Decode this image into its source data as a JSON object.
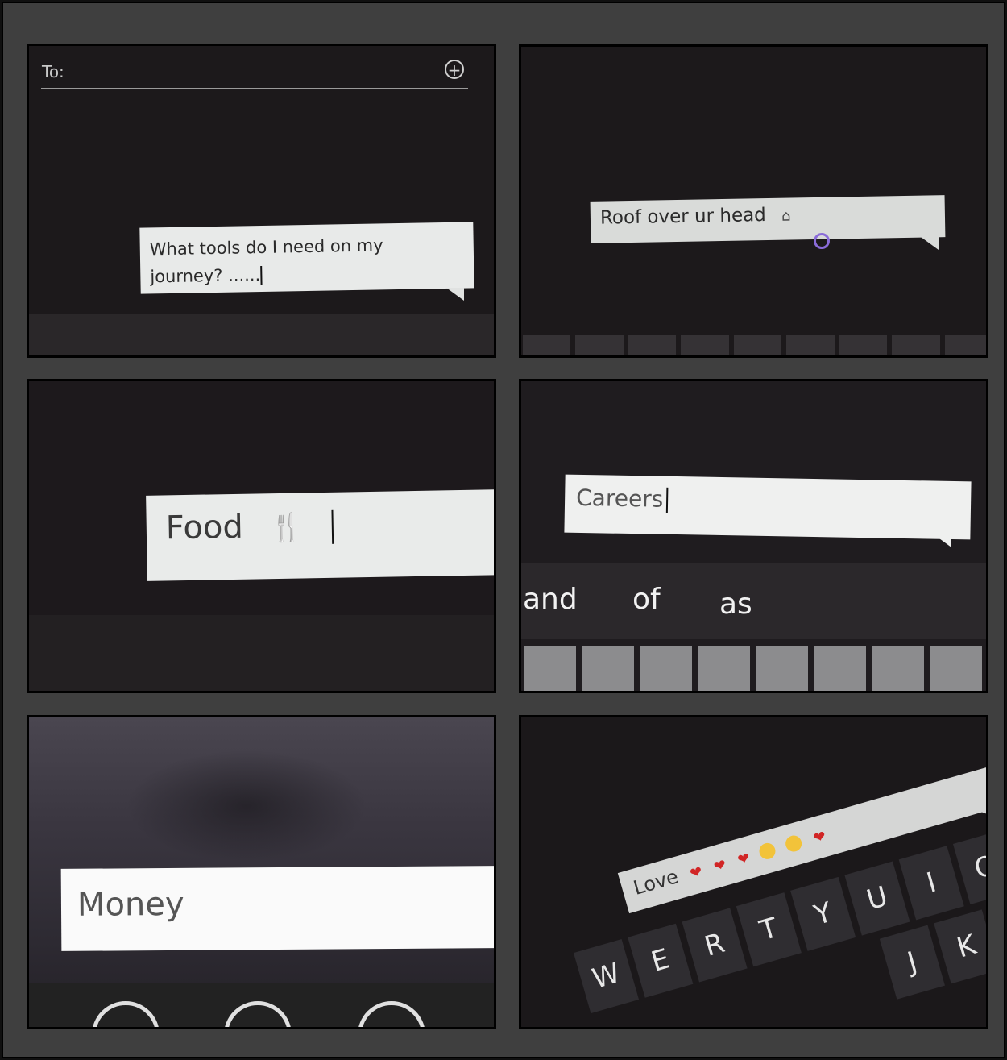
{
  "panel1": {
    "to_label": "To:",
    "add_icon": "add-circle-icon",
    "message_line1": "What tools do I need on my",
    "message_line2": "journey? ......"
  },
  "panel2": {
    "message": "Roof over ur head",
    "icon": "home-icon"
  },
  "panel3": {
    "message": "Food",
    "icon": "fork-knife-icon"
  },
  "panel4": {
    "message": "Careers",
    "suggestions": [
      "and",
      "of",
      "as"
    ]
  },
  "panel5": {
    "message": "Money"
  },
  "panel6": {
    "message": "Love",
    "emoji_icons": [
      "heart-icon",
      "hearts-icon",
      "hearts-icon",
      "smile-face-icon",
      "kiss-face-icon",
      "heart-face-icon"
    ],
    "key_row_top": [
      "W",
      "E",
      "R",
      "T",
      "Y",
      "U",
      "I",
      "O"
    ],
    "key_row_bottom": [
      "J",
      "K"
    ]
  },
  "colors": {
    "frame": "#3f3f3f",
    "bubble": "#e8eae9",
    "touch_ring": "#8a6bd8",
    "heart": "#d12525",
    "face": "#f2c33a"
  }
}
